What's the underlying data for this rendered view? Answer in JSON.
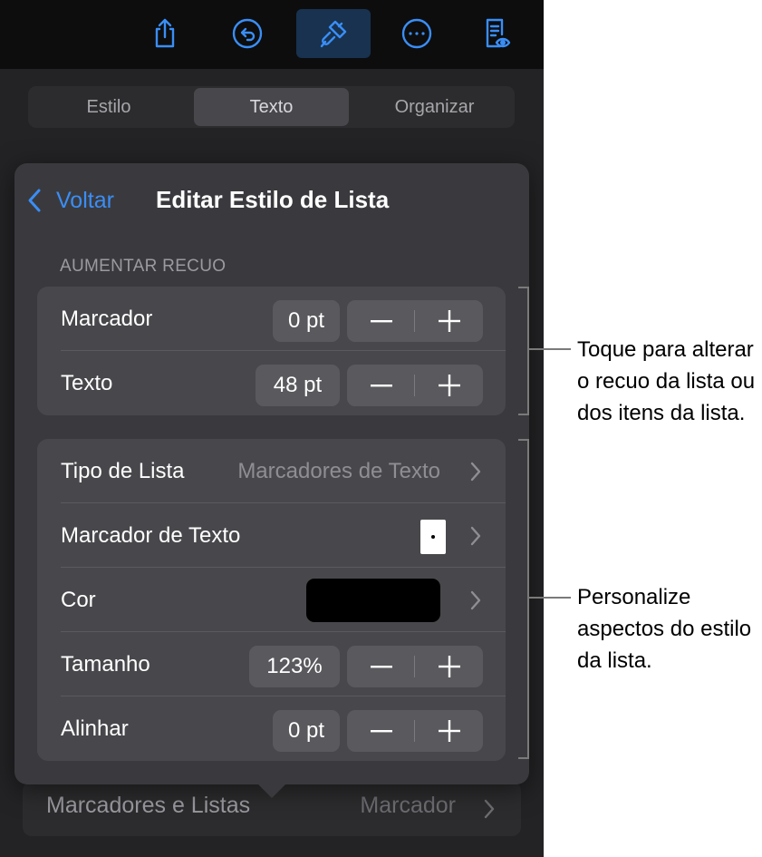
{
  "toolbar": {
    "icons": [
      "share-icon",
      "undo-icon",
      "format-brush-icon",
      "more-icon",
      "reading-view-icon"
    ],
    "accent": "#3a8ef6"
  },
  "segmented": {
    "tabs": [
      "Estilo",
      "Texto",
      "Organizar"
    ],
    "selected": "Texto"
  },
  "popover": {
    "back_label": "Voltar",
    "title": "Editar Estilo de Lista",
    "indent_section": {
      "header": "AUMENTAR RECUO",
      "rows": [
        {
          "label": "Marcador",
          "value": "0 pt"
        },
        {
          "label": "Texto",
          "value": "48 pt"
        }
      ]
    },
    "style_section": {
      "list_type": {
        "label": "Tipo de Lista",
        "value": "Marcadores de Texto"
      },
      "text_bullet": {
        "label": "Marcador de Texto",
        "value": "•"
      },
      "color": {
        "label": "Cor",
        "swatch": "#000000"
      },
      "size": {
        "label": "Tamanho",
        "value": "123%"
      },
      "align": {
        "label": "Alinhar",
        "value": "0 pt"
      }
    },
    "stepper": {
      "minus": "−",
      "plus": "+"
    }
  },
  "underlay": {
    "label": "Marcadores e Listas",
    "value": "Marcador"
  },
  "callouts": {
    "indent": "Toque para alterar o recuo da lista ou dos itens da lista.",
    "style": "Personalize aspectos do estilo da lista."
  }
}
